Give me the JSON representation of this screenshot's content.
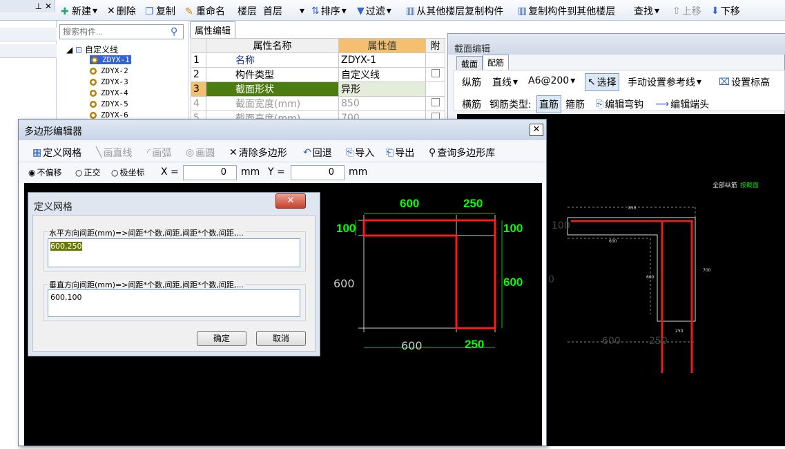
{
  "main_toolbar": {
    "new": "新建",
    "delete": "删除",
    "copy": "复制",
    "rename": "重命名",
    "floor_label": "楼层",
    "floor_value": "首层",
    "sort": "排序",
    "filter": "过滤",
    "copy_from_floor": "从其他楼层复制构件",
    "copy_to_floor": "复制构件到其他楼层",
    "find": "查找",
    "move_up": "上移",
    "move_down": "下移"
  },
  "search": {
    "placeholder": "搜索构件..."
  },
  "tree": {
    "root": "自定义线",
    "items": [
      "ZDYX-1",
      "ZDYX-2",
      "ZDYX-3",
      "ZDYX-4",
      "ZDYX-5",
      "ZDYX-6"
    ]
  },
  "prop": {
    "tab": "属性编辑",
    "headers": [
      "属性名称",
      "属性值",
      "附"
    ],
    "rows": [
      {
        "no": "1",
        "name": "名称",
        "value": "ZDYX-1"
      },
      {
        "no": "2",
        "name": "构件类型",
        "value": "自定义线"
      },
      {
        "no": "3",
        "name": "截面形状",
        "value": "异形"
      },
      {
        "no": "4",
        "name": "截面宽度(mm)",
        "value": "850"
      },
      {
        "no": "5",
        "name": "截面高度(mm)",
        "value": "700"
      }
    ]
  },
  "section": {
    "title": "截面编辑",
    "tabs": [
      "截面",
      "配筋"
    ],
    "row1": {
      "long": "纵筋",
      "line": "直线",
      "spec": "A6@200",
      "select": "选择",
      "manual_ref": "手动设置参考线",
      "set_height": "设置标高"
    },
    "row2": {
      "stirrup": "横筋",
      "type_label": "钢筋类型:",
      "type_value": "直筋",
      "tie": "箍筋",
      "edit_hook": "编辑弯钩",
      "edit_end": "编辑端头"
    },
    "annotation": "全部纵筋",
    "annotation2": "按截面",
    "dims": {
      "top": "850",
      "w600": "600",
      "h700": "700",
      "h600": "600",
      "w250": "250",
      "b600": "600",
      "b250": "250",
      "left0": "0",
      "left100": "100"
    }
  },
  "poly": {
    "title": "多边形编辑器",
    "tools": {
      "define_grid": "定义网格",
      "draw_line": "画直线",
      "draw_arc": "画弧",
      "draw_circle": "画圆",
      "clear": "清除多边形",
      "undo": "回退",
      "import": "导入",
      "export": "导出",
      "query": "查询多边形库"
    },
    "modes": {
      "no_offset": "不偏移",
      "ortho": "正交",
      "polar": "极坐标"
    },
    "x_label": "X =",
    "x_value": "0",
    "y_label": "Y =",
    "y_value": "0",
    "unit": "mm"
  },
  "grid_dialog": {
    "title": "定义网格",
    "horiz_label": "水平方向间距(mm)=>间距*个数,间距,间距*个数,间距,...",
    "horiz_value": "600,250",
    "vert_label": "垂直方向间距(mm)=>间距*个数,间距,间距*个数,间距,...",
    "vert_value": "600,100",
    "ok": "确定",
    "cancel": "取消"
  },
  "canvas_dims": {
    "top600": "600",
    "top250": "250",
    "left100": "100",
    "right100": "100",
    "left600": "600",
    "right600": "600",
    "bottom600": "600",
    "bottom250": "250"
  }
}
